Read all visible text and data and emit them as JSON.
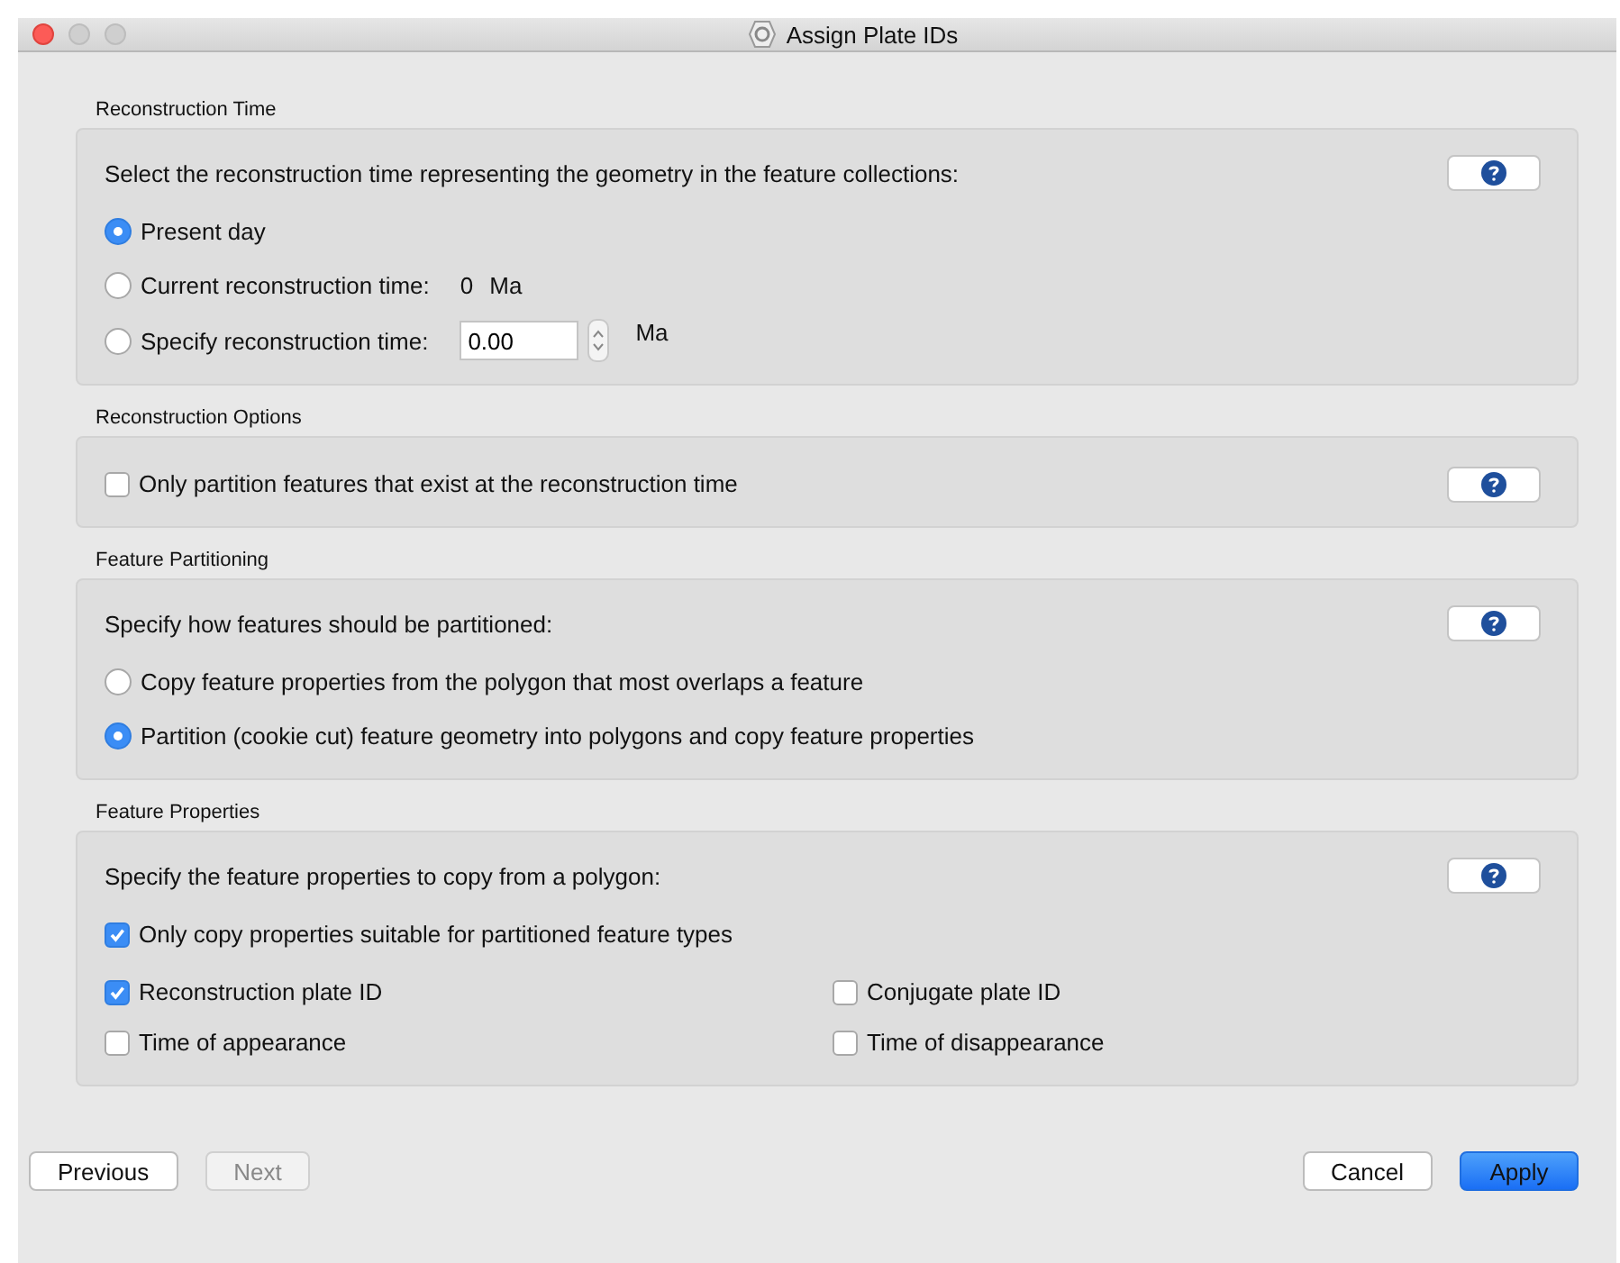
{
  "window": {
    "title": "Assign Plate IDs"
  },
  "sections": [
    {
      "title": "Reconstruction Time",
      "prompt": "Select the reconstruction time representing the geometry in the feature collections:",
      "items": [
        {
          "kind": "radio",
          "label": "Present day",
          "selected": true
        },
        {
          "kind": "radio_value",
          "label": "Current reconstruction time:",
          "selected": false,
          "value": "0",
          "unit": "Ma"
        },
        {
          "kind": "radio_field",
          "label": "Specify reconstruction time:",
          "selected": false,
          "field_value": "0.00",
          "unit": "Ma"
        }
      ]
    },
    {
      "title": "Reconstruction Options",
      "items": [
        {
          "kind": "checkbox",
          "label": "Only partition features that exist at the reconstruction time",
          "checked": false
        }
      ]
    },
    {
      "title": "Feature Partitioning",
      "prompt": "Specify how features should be partitioned:",
      "items": [
        {
          "kind": "radio",
          "label": "Copy feature properties from the polygon that most overlaps a feature",
          "selected": false
        },
        {
          "kind": "radio",
          "label": "Partition (cookie cut) feature geometry into polygons and copy feature properties",
          "selected": true
        }
      ]
    },
    {
      "title": "Feature Properties",
      "prompt": "Specify the feature properties to copy from a polygon:",
      "items": [
        {
          "kind": "checkbox",
          "label": "Only copy properties suitable for partitioned feature types",
          "checked": true
        }
      ],
      "grid": [
        {
          "label": "Reconstruction plate ID",
          "checked": true
        },
        {
          "label": "Conjugate plate ID",
          "checked": false
        },
        {
          "label": "Time of appearance",
          "checked": false
        },
        {
          "label": "Time of disappearance",
          "checked": false
        }
      ]
    }
  ],
  "nav_buttons": [
    {
      "label": "Previous",
      "disabled": false
    },
    {
      "label": "Next",
      "disabled": true
    }
  ],
  "action_buttons": [
    {
      "label": "Cancel",
      "default": false
    },
    {
      "label": "Apply",
      "default": true
    }
  ]
}
